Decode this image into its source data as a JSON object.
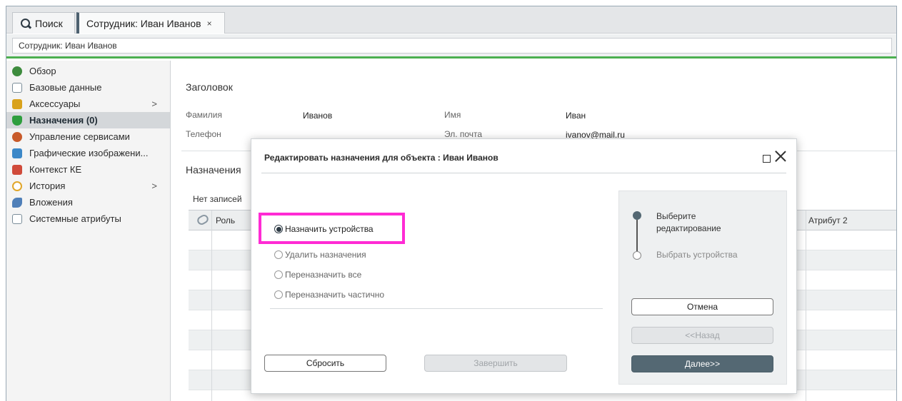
{
  "tabs": {
    "search_label": "Поиск",
    "active_label": "Сотрудник: Иван Иванов",
    "close_glyph": "×"
  },
  "breadcrumb": "Сотрудник: Иван Иванов",
  "sidebar": {
    "items": [
      {
        "label": "Обзор",
        "icon": "overview-icon",
        "color": "#3d8b3d"
      },
      {
        "label": "Базовые данные",
        "icon": "document-icon",
        "color": "#7b8d99"
      },
      {
        "label": "Аксессуары",
        "icon": "accessories-icon",
        "color": "#d9a21b",
        "chevron": ">"
      },
      {
        "label": "Назначения (0)",
        "icon": "assignments-icon",
        "color": "#2e9e3e"
      },
      {
        "label": "Управление сервисами",
        "icon": "services-icon",
        "color": "#c85a2a"
      },
      {
        "label": "Графические изображени...",
        "icon": "images-icon",
        "color": "#3c88c8"
      },
      {
        "label": "Контекст КЕ",
        "icon": "context-icon",
        "color": "#d04a3a"
      },
      {
        "label": "История",
        "icon": "history-icon",
        "color": "#e0a62a",
        "chevron": ">"
      },
      {
        "label": "Вложения",
        "icon": "attachments-icon",
        "color": "#4f7fb8"
      },
      {
        "label": "Системные атрибуты",
        "icon": "system-attributes-icon",
        "color": "#7b8d99"
      }
    ]
  },
  "header_section": {
    "title": "Заголовок",
    "fields": {
      "lastname_label": "Фамилия",
      "lastname_value": "Иванов",
      "firstname_label": "Имя",
      "firstname_value": "Иван",
      "phone_label": "Телефон",
      "phone_value": "",
      "email_label": "Эл. почта",
      "email_value": "ivanov@mail.ru"
    }
  },
  "assignments_section": {
    "title": "Назначения",
    "empty_text": "Нет записей",
    "columns": {
      "role": "Роль",
      "attr2": "Атрибут 2"
    }
  },
  "dialog": {
    "title": "Редактировать назначения для объекта : Иван Иванов",
    "options": [
      {
        "label": "Назначить устройства",
        "selected": true
      },
      {
        "label": "Удалить назначения",
        "selected": false
      },
      {
        "label": "Переназначить все",
        "selected": false
      },
      {
        "label": "Переназначить частично",
        "selected": false
      }
    ],
    "reset_label": "Сбросить",
    "finish_label": "Завершить",
    "wizard": {
      "step1": "Выберите редактирование",
      "step2": "Выбрать устройства"
    },
    "cancel_label": "Отмена",
    "back_label": "<<Назад",
    "next_label": "Далее>>"
  }
}
